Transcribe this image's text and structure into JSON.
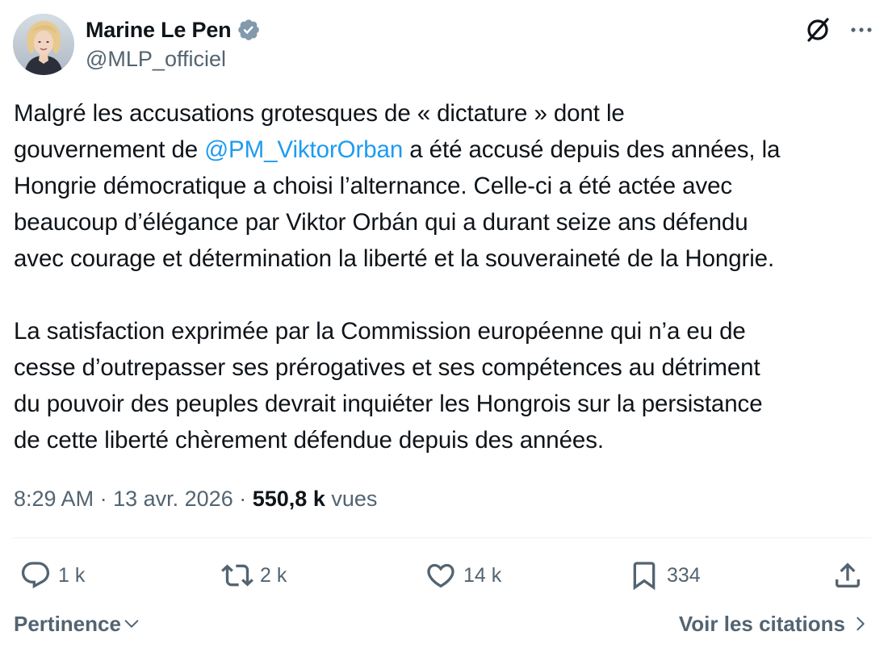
{
  "author": {
    "display_name": "Marine Le Pen",
    "handle": "@MLP_officiel",
    "verified_icon": "verified-badge-icon",
    "verified_color": "#829aab"
  },
  "tweet": {
    "paragraph1_before": "Malgré les accusations grotesques de « dictature » dont le\ngouvernement de ",
    "mention": "@PM_ViktorOrban",
    "paragraph1_after": " a été accusé depuis des années, la\nHongrie démocratique a choisi l’alternance. Celle-ci a été actée avec\nbeaucoup d’élégance par Viktor Orbán qui a durant seize ans défendu\navec courage et détermination la liberté et la souveraineté de la Hongrie.",
    "paragraph2": "La satisfaction exprimée par la Commission européenne qui n’a eu de\ncesse d’outrepasser ses prérogatives et ses compétences au détriment\ndu pouvoir des peuples devrait inquiéter les Hongrois sur la persistance\nde cette liberté chèrement défendue depuis des années."
  },
  "meta": {
    "time": "8:29 AM",
    "separator": "·",
    "date": "13 avr. 2026",
    "views_count": "550,8 k",
    "views_label": "vues"
  },
  "actions": {
    "replies": "1 k",
    "reposts": "2 k",
    "likes": "14 k",
    "bookmarks": "334"
  },
  "footer": {
    "sort_label": "Pertinence",
    "quotes_label": "Voir les citations"
  },
  "colors": {
    "text": "#0f1419",
    "secondary": "#536471",
    "link": "#1d9bf0",
    "divider": "#eff3f4"
  }
}
